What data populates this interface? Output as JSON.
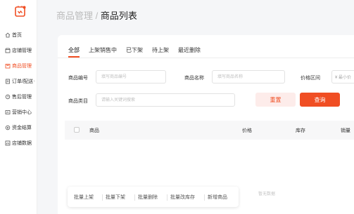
{
  "sidebar": {
    "logo_color": "#f04e23",
    "items": [
      {
        "label": "首页",
        "icon": "home-icon"
      },
      {
        "label": "店铺管理",
        "icon": "store-icon"
      },
      {
        "label": "商品管理",
        "icon": "goods-icon",
        "active": true
      },
      {
        "label": "订单/配送",
        "icon": "order-icon"
      },
      {
        "label": "售后管理",
        "icon": "after-sale-icon"
      },
      {
        "label": "营销中心",
        "icon": "marketing-icon"
      },
      {
        "label": "资金结算",
        "icon": "finance-icon"
      },
      {
        "label": "店铺数据",
        "icon": "data-icon"
      }
    ]
  },
  "header": {
    "breadcrumb_parent": "商品管理",
    "separator": "/",
    "title": "商品列表"
  },
  "tabs": [
    "全部",
    "上架销售中",
    "已下架",
    "待上架",
    "最近删除"
  ],
  "active_tab": "全部",
  "filters": {
    "code_label": "商品编号",
    "code_placeholder": "填写商品编号",
    "name_label": "商品名称",
    "name_placeholder": "填写商品名称",
    "price_label": "价格区间",
    "price_placeholder": "¥ 最小价",
    "category_label": "商品类目",
    "category_placeholder": "请输入关键词搜索"
  },
  "buttons": {
    "reset": "重置",
    "query": "查询"
  },
  "table": {
    "columns": [
      "商品",
      "价格",
      "库存",
      "销量"
    ],
    "empty_text": "暂无数据"
  },
  "bulk_actions": [
    "批量上架",
    "批量下架",
    "批量删除",
    "批量改库存",
    "新增商品"
  ],
  "colors": {
    "accent": "#f04e23",
    "accent_light": "#fdecea"
  }
}
